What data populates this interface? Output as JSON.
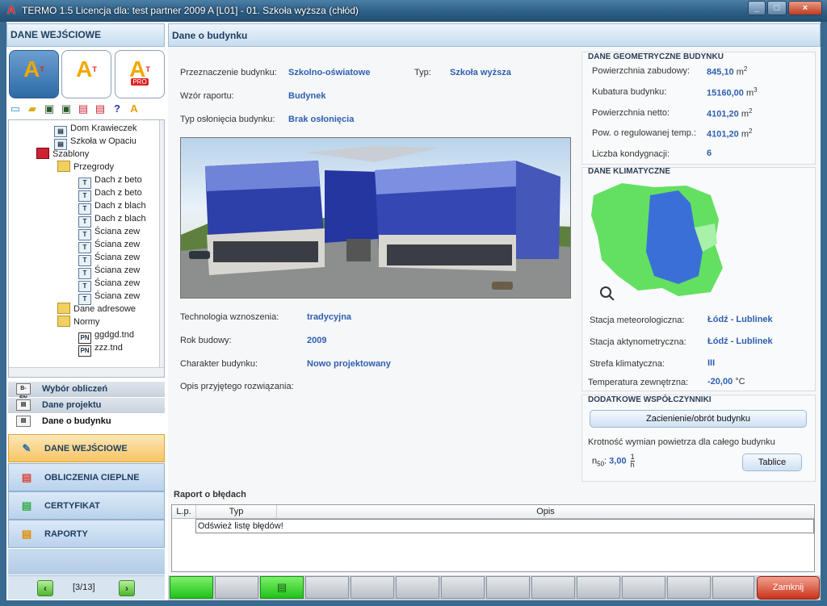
{
  "window": {
    "title": "TERMO 1.5 Licencja dla: test partner 2009 A [L01] - 01. Szkoła wyższa (chłód)",
    "logo": "A",
    "min": "_",
    "max": "□",
    "close": "×"
  },
  "left": {
    "header": "DANE WEJŚCIOWE",
    "big_buttons": [
      {
        "glyph": "A",
        "sup": "T"
      },
      {
        "glyph": "A",
        "sup": "T"
      },
      {
        "glyph": "A",
        "sup": "T",
        "badge": "PRO"
      }
    ],
    "tree": [
      {
        "label": "Dom Krawieczek",
        "icon": "building-icon"
      },
      {
        "label": "Szkoła w Opaciu",
        "icon": "building-icon"
      },
      {
        "label": "Szablony",
        "icon": "templates-icon"
      },
      {
        "label": "Przegrody",
        "icon": "folder-icon"
      },
      {
        "label": "Dach z beto",
        "icon": "partition-icon"
      },
      {
        "label": "Dach z beto",
        "icon": "partition-icon"
      },
      {
        "label": "Dach z blach",
        "icon": "partition-icon"
      },
      {
        "label": "Dach z blach",
        "icon": "partition-icon"
      },
      {
        "label": "Ściana zew",
        "icon": "partition-icon"
      },
      {
        "label": "Ściana zew",
        "icon": "partition-icon"
      },
      {
        "label": "Ściana zew",
        "icon": "partition-icon"
      },
      {
        "label": "Ściana zew",
        "icon": "partition-icon"
      },
      {
        "label": "Ściana zew",
        "icon": "partition-icon"
      },
      {
        "label": "Ściana zew",
        "icon": "partition-icon"
      },
      {
        "label": "Dane adresowe",
        "icon": "folder-icon"
      },
      {
        "label": "Normy",
        "icon": "folder-icon"
      },
      {
        "label": "ggdgd.tnd",
        "icon": "pn-icon"
      },
      {
        "label": "zzz.tnd",
        "icon": "pn-icon"
      }
    ],
    "subnav": [
      "Wybór obliczeń",
      "Dane projektu",
      "Dane o budynku"
    ],
    "mainnav": [
      "DANE WEJŚCIOWE",
      "OBLICZENIA CIEPLNE",
      "CERTYFIKAT",
      "RAPORTY"
    ],
    "pager": "[3/13]",
    "pn_badge": "PN",
    "subnav_badge": "B-EN"
  },
  "main": {
    "header": "Dane o budynku",
    "przeznaczenie_label": "Przeznaczenie budynku:",
    "przeznaczenie": "Szkolno-oświatowe",
    "typ_label": "Typ:",
    "typ": "Szkoła wyższa",
    "wzor_label": "Wzór raportu:",
    "wzor": "Budynek",
    "oslona_label": "Typ osłonięcia budynku:",
    "oslona": "Brak osłonięcia",
    "technologia_label": "Technologia wznoszenia:",
    "technologia": "tradycyjna",
    "rok_label": "Rok budowy:",
    "rok": "2009",
    "charakter_label": "Charakter budynku:",
    "charakter": "Nowo projektowany",
    "opis_label": "Opis przyjętego rozwiązania:"
  },
  "geo": {
    "title": "DANE GEOMETRYCZNE BUDYNKU",
    "rows": [
      {
        "label": "Powierzchnia zabudowy:",
        "value": "845,10",
        "unit": "m",
        "sup": "2"
      },
      {
        "label": "Kubatura budynku:",
        "value": "15160,00",
        "unit": "m",
        "sup": "3"
      },
      {
        "label": "Powierzchnia netto:",
        "value": "4101,20",
        "unit": "m",
        "sup": "2"
      },
      {
        "label": "Pow. o regulowanej temp.:",
        "value": "4101,20",
        "unit": "m",
        "sup": "2"
      },
      {
        "label": "Liczba kondygnacji:",
        "value": "6",
        "unit": "",
        "sup": ""
      }
    ]
  },
  "climate": {
    "title": "DANE KLIMATYCZNE",
    "rows": [
      {
        "label": "Stacja meteorologiczna:",
        "value": "Łódź - Lublinek"
      },
      {
        "label": "Stacja aktynometryczna:",
        "value": "Łódź - Lublinek"
      },
      {
        "label": "Strefa klimatyczna:",
        "value": "III"
      },
      {
        "label": "Temperatura zewnętrzna:",
        "value": "-20,00",
        "unit": "°C"
      }
    ]
  },
  "extra": {
    "title": "DODATKOWE WSPÓŁCZYNNIKI",
    "btn_zacienienie": "Zacienienie/obrót budynku",
    "krotnosc_label": "Krotność wymian powietrza dla całego budynku",
    "n50_label": "n",
    "n50_sub": "50",
    "n50_value": "3,00",
    "n50_unit_num": "1",
    "n50_unit_den": "h",
    "btn_tablice": "Tablice"
  },
  "errors": {
    "title": "Raport o błędach",
    "columns": [
      "L.p.",
      "Typ",
      "Opis"
    ],
    "row": "Odśwież listę błędów!"
  },
  "bottom": {
    "zamknij": "Zamknij"
  }
}
